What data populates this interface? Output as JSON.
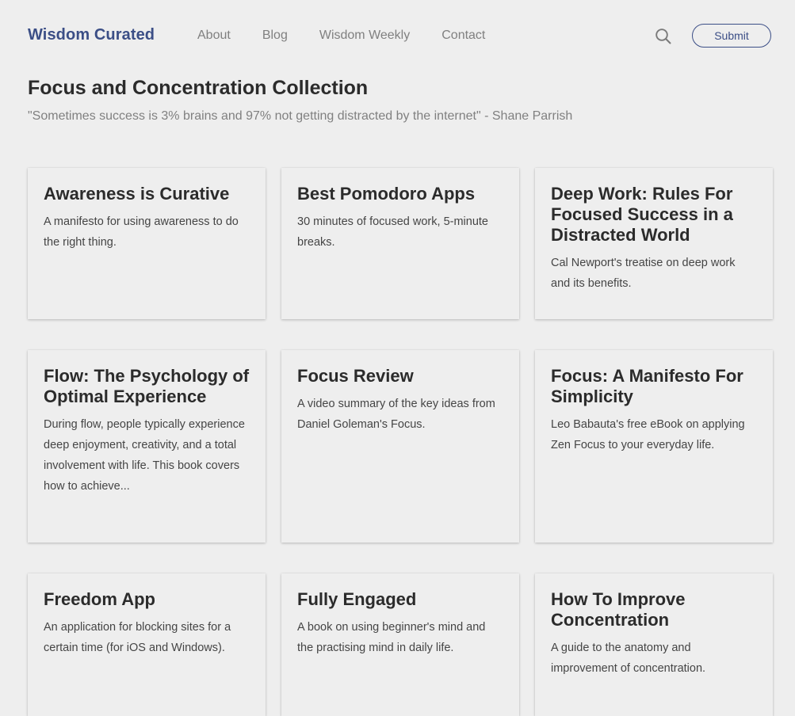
{
  "header": {
    "brand": "Wisdom Curated",
    "nav": [
      "About",
      "Blog",
      "Wisdom Weekly",
      "Contact"
    ],
    "search_icon": "search-icon",
    "submit_label": "Submit",
    "accent_color": "#3b4e86"
  },
  "page": {
    "title": "Focus and Concentration Collection",
    "quote": "\"Sometimes success is 3% brains and 97% not getting distracted by the internet\" - Shane Parrish"
  },
  "cards": [
    {
      "title": "Awareness is Curative",
      "description": "A manifesto for using awareness to do the right thing."
    },
    {
      "title": "Best Pomodoro Apps",
      "description": "30 minutes of focused work, 5-minute breaks."
    },
    {
      "title": "Deep Work: Rules For Focused Success in a Distracted World",
      "description": "Cal Newport's treatise on deep work and its benefits."
    },
    {
      "title": "Flow: The Psychology of Optimal Experience",
      "description": "During flow, people typically experience deep enjoyment, creativity, and a total involvement with life. This book covers how to achieve..."
    },
    {
      "title": "Focus Review",
      "description": "A video summary of the key ideas from Daniel Goleman's Focus."
    },
    {
      "title": "Focus: A Manifesto For Simplicity",
      "description": "Leo Babauta's free eBook on applying Zen Focus to your everyday life."
    },
    {
      "title": "Freedom App",
      "description": "An application for blocking sites for a certain time (for iOS and Windows)."
    },
    {
      "title": "Fully Engaged",
      "description": "A book on using beginner's mind and the practising mind in daily life."
    },
    {
      "title": "How To Improve Concentration",
      "description": "A guide to the anatomy and improvement of concentration."
    }
  ]
}
